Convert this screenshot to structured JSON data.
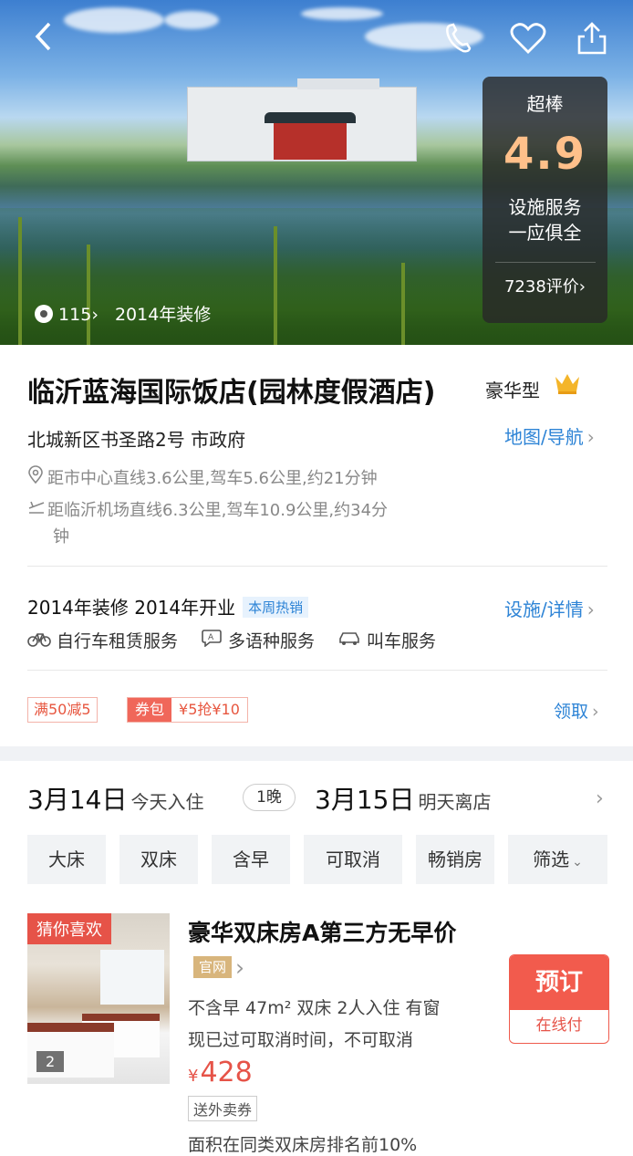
{
  "hero": {
    "photo_count": "115",
    "photo_label": "2014年装修",
    "rating_level": "超棒",
    "rating_score": "4.9",
    "rating_desc_1": "设施服务",
    "rating_desc_2": "一应俱全",
    "review_count": "7238评价"
  },
  "hotel": {
    "name": "临沂蓝海国际饭店(园林度假酒店)",
    "star_type": "豪华型",
    "address": "北城新区书圣路2号  市政府",
    "map_link": "地图/导航",
    "distance_center": "距市中心直线3.6公里,驾车5.6公里,约21分钟",
    "distance_airport_1": "距临沂机场直线6.3公里,驾车10.9公里,约34分",
    "distance_airport_2": "钟"
  },
  "facilities": {
    "renovation": "2014年装修  2014年开业",
    "hot_tag": "本周热销",
    "link": "设施/详情",
    "services": [
      "自行车租赁服务",
      "多语种服务",
      "叫车服务"
    ]
  },
  "coupons": {
    "discount": "满50减5",
    "pack_label": "券包",
    "pack_value": "¥5抢¥10",
    "claim": "领取"
  },
  "dates": {
    "checkin": "3月14日",
    "checkin_note": "今天入住",
    "nights": "1晚",
    "checkout": "3月15日",
    "checkout_note": "明天离店"
  },
  "filters": [
    "大床",
    "双床",
    "含早",
    "可取消",
    "畅销房",
    "筛选"
  ],
  "room": {
    "tag": "猜你喜欢",
    "image_count": "2",
    "name": "豪华双床房A第三方无早价",
    "official": "官网",
    "details": "不含早 47m² 双床 2人入住 有窗",
    "cancel": "现已过可取消时间，不可取消",
    "currency": "¥",
    "price": "428",
    "delivery": "送外卖券",
    "rank": "面积在同类双床房排名前10%",
    "book": "预订",
    "pay": "在线付"
  }
}
